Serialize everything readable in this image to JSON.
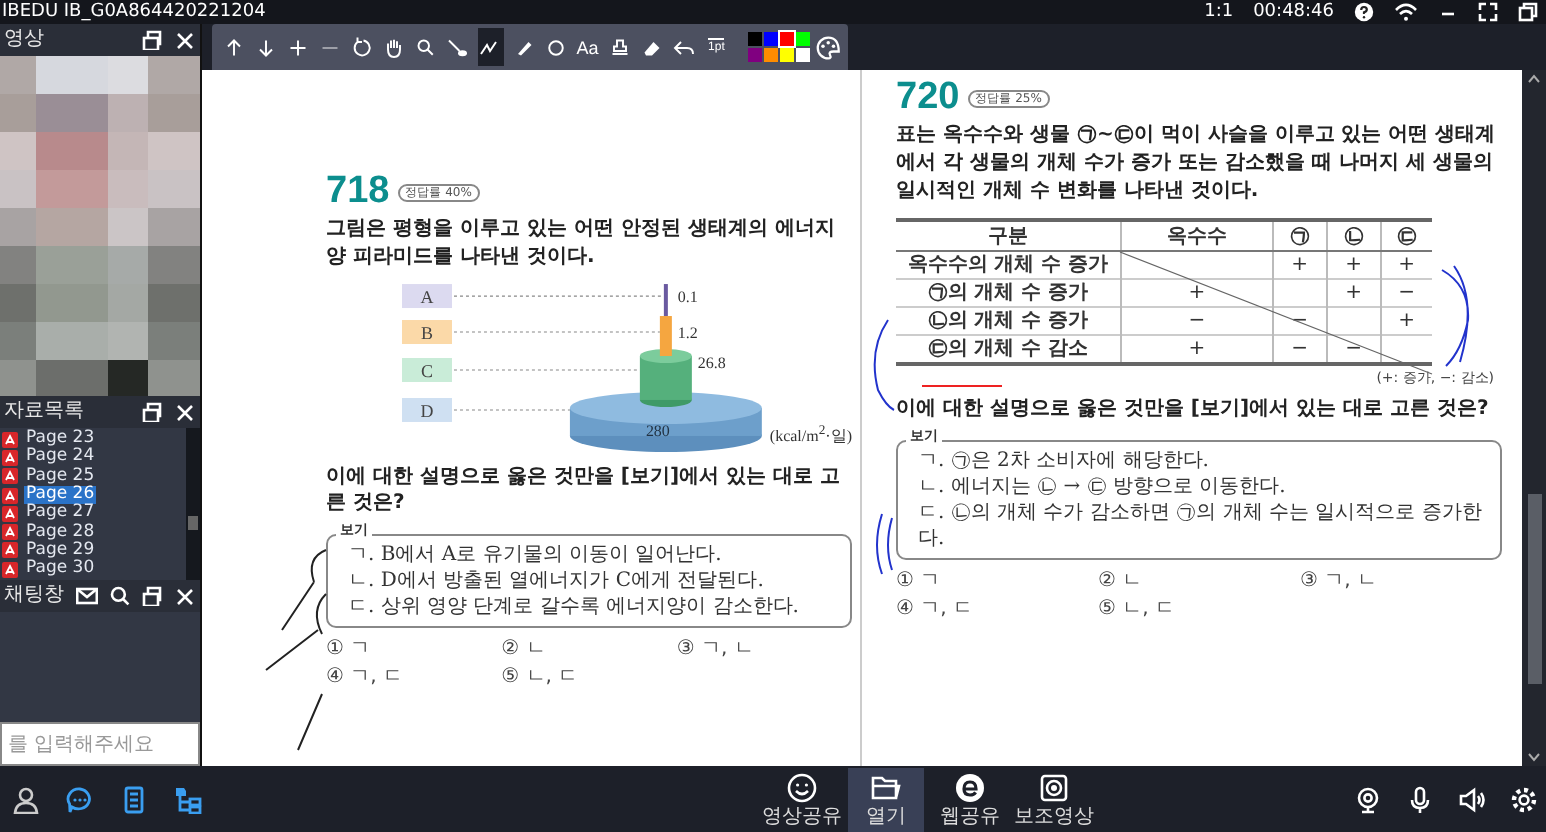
{
  "window": {
    "title": "IBEDU IB_G0A864420221204",
    "zoom": "1:1",
    "elapsed": "00:48:46"
  },
  "toolbar": {
    "tools": [
      {
        "selected": false,
        "disabled": false
      },
      {
        "selected": false,
        "disabled": false
      },
      {
        "selected": false,
        "disabled": false
      },
      {
        "selected": false,
        "disabled": true
      },
      {
        "selected": false,
        "disabled": false
      },
      {
        "selected": false,
        "disabled": false
      },
      {
        "selected": false,
        "disabled": false
      },
      {
        "selected": false,
        "disabled": false
      },
      {
        "selected": true,
        "disabled": false
      },
      {
        "selected": false,
        "disabled": false
      },
      {
        "selected": false,
        "disabled": false
      },
      {
        "label": "Aa",
        "selected": false,
        "disabled": false
      },
      {
        "selected": false,
        "disabled": false
      },
      {
        "selected": false,
        "disabled": false
      },
      {
        "selected": false,
        "disabled": false
      },
      {
        "label": "1pt",
        "selected": false,
        "disabled": false
      }
    ],
    "colors": [
      {
        "color": "#000000",
        "selected": false
      },
      {
        "color": "#0000ff",
        "selected": false
      },
      {
        "color": "#ff0000",
        "selected": true
      },
      {
        "color": "#00ff00",
        "selected": false
      },
      {
        "color": "#800080",
        "selected": false
      },
      {
        "color": "#ff8c00",
        "selected": false
      },
      {
        "color": "#ffff00",
        "selected": false
      },
      {
        "color": "#ffffff",
        "selected": false
      }
    ]
  },
  "sidebar": {
    "video_panel": {
      "title": "영상"
    },
    "materials_panel": {
      "title": "자료목록",
      "items": [
        {
          "label": "Page 23",
          "selected": false
        },
        {
          "label": "Page 24",
          "selected": false
        },
        {
          "label": "Page 25",
          "selected": false
        },
        {
          "label": "Page 26",
          "selected": true
        },
        {
          "label": "Page 27",
          "selected": false
        },
        {
          "label": "Page 28",
          "selected": false
        },
        {
          "label": "Page 29",
          "selected": false
        },
        {
          "label": "Page 30",
          "selected": false
        }
      ]
    },
    "chat_panel": {
      "title": "채팅창",
      "placeholder": "를 입력해주세요"
    }
  },
  "left_page": {
    "number": "718",
    "rate": "정답률 40%",
    "question": "그림은 평형을 이루고 있는 어떤 안정된 생태계의 에너지양 피라미드를 나타낸 것이다.",
    "figure": {
      "levels": [
        {
          "label": "A",
          "color": "#dcdaf0",
          "value": "0.1"
        },
        {
          "label": "B",
          "color": "#fbd9a8",
          "value": "1.2"
        },
        {
          "label": "C",
          "color": "#c9ecd8",
          "value": "26.8"
        },
        {
          "label": "D",
          "color": "#cfe0f2",
          "value": "280"
        }
      ],
      "unit": "(kcal/m$^{2}$·일)"
    },
    "prompt": "이에 대한 설명으로 옳은 것만을 [보기]에서 있는 대로 고른 것은?",
    "box_title": "보기",
    "statements": [
      "ㄱ. B에서 A로 유기물의 이동이 일어난다.",
      "ㄴ. D에서 방출된 열에너지가 C에게 전달된다.",
      "ㄷ. 상위 영양 단계로 갈수록 에너지양이 감소한다."
    ],
    "options": [
      "① ㄱ",
      "② ㄴ",
      "③ ㄱ, ㄴ",
      "④ ㄱ, ㄷ",
      "⑤ ㄴ, ㄷ"
    ]
  },
  "right_page": {
    "number": "720",
    "rate": "정답률 25%",
    "question": "표는 옥수수와 생물 ㉠~㉢이 먹이 사슬을 이루고 있는 어떤 생태계에서 각 생물의 개체 수가 증가 또는 감소했을 때 나머지 세 생물의 일시적인 개체 수 변화를 나타낸 것이다.",
    "table": {
      "columns": [
        "구분",
        "옥수수",
        "㉠",
        "㉡",
        "㉢"
      ],
      "rows": [
        [
          "옥수수의 개체 수 증가",
          null,
          "+",
          "+",
          "+"
        ],
        [
          "㉠의 개체 수 증가",
          "+",
          null,
          "+",
          "−"
        ],
        [
          "㉡의 개체 수 증가",
          "−",
          "−",
          null,
          "+"
        ],
        [
          "㉢의 개체 수 감소",
          "+",
          "−",
          "−",
          null
        ]
      ]
    },
    "legend": "(+: 증가, −: 감소)",
    "prompt": "이에 대한 설명으로 옳은 것만을 [보기]에서 있는 대로 고른 것은?",
    "box_title": "보기",
    "statements": [
      "ㄱ. ㉠은 2차 소비자에 해당한다.",
      "ㄴ. 에너지는 ㉡ → ㉢ 방향으로 이동한다.",
      "ㄷ. ㉡의 개체 수가 감소하면 ㉠의 개체 수는 일시적으로 증가한다."
    ],
    "options": [
      "① ㄱ",
      "② ㄴ",
      "③ ㄱ, ㄴ",
      "④ ㄱ, ㄷ",
      "⑤ ㄴ, ㄷ"
    ]
  },
  "bottom_bar": {
    "buttons": [
      {
        "label": "영상공유",
        "selected": false
      },
      {
        "label": "열기",
        "selected": true
      },
      {
        "label": "웹공유",
        "selected": false
      },
      {
        "label": "보조영상",
        "selected": false
      }
    ]
  }
}
